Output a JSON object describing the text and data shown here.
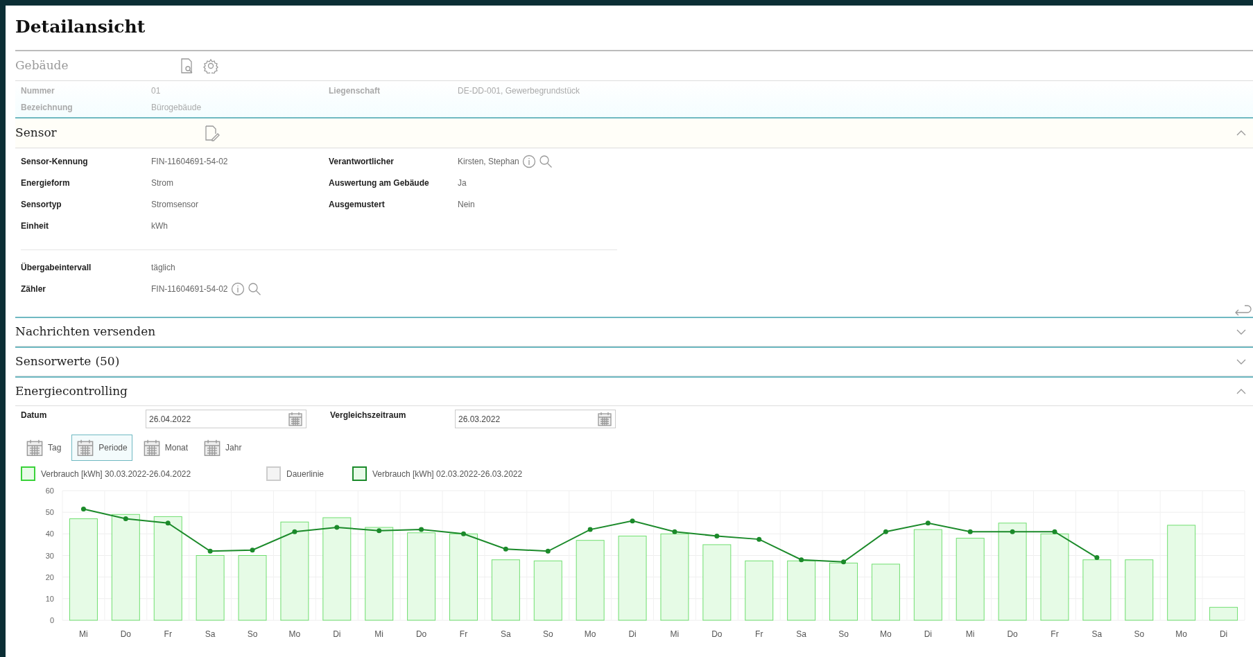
{
  "page_title": "Detailansicht",
  "building": {
    "title": "Gebäude",
    "rows": [
      {
        "cells": [
          {
            "label": "Nummer",
            "value": "01"
          },
          {
            "label": "Liegenschaft",
            "value": "DE-DD-001, Gewerbegrundstück"
          }
        ]
      },
      {
        "cells": [
          {
            "label": "Bezeichnung",
            "value": "Bürogebäude"
          }
        ]
      }
    ]
  },
  "sensor": {
    "title": "Sensor",
    "expanded": true,
    "groups": [
      [
        {
          "cells": [
            {
              "label": "Sensor-Kennung",
              "value": "FIN-11604691-54-02"
            },
            {
              "label": "Verantwortlicher",
              "value": "Kirsten, Stephan",
              "lookup": true
            }
          ]
        },
        {
          "cells": [
            {
              "label": "Energieform",
              "value": "Strom"
            },
            {
              "label": "Auswertung am Gebäude",
              "value": "Ja"
            }
          ]
        },
        {
          "cells": [
            {
              "label": "Sensortyp",
              "value": "Stromsensor"
            },
            {
              "label": "Ausgemustert",
              "value": "Nein"
            }
          ]
        },
        {
          "cells": [
            {
              "label": "Einheit",
              "value": "kWh"
            }
          ]
        }
      ],
      [
        {
          "cells": [
            {
              "label": "Übergabeintervall",
              "value": "täglich"
            }
          ]
        },
        {
          "cells": [
            {
              "label": "Zähler",
              "value": "FIN-11604691-54-02",
              "lookup": true
            }
          ]
        }
      ]
    ]
  },
  "collapsed_sections": [
    {
      "title": "Nachrichten versenden",
      "expanded": false
    },
    {
      "title": "Sensorwerte",
      "count": "(50)",
      "expanded": false
    }
  ],
  "energy": {
    "title": "Energiecontrolling",
    "expanded": true,
    "date_fields": [
      {
        "label": "Datum",
        "value": "26.04.2022"
      },
      {
        "label": "Vergleichszeitraum",
        "value": "26.03.2022"
      }
    ],
    "ranges": [
      {
        "label": "Tag",
        "selected": false
      },
      {
        "label": "Periode",
        "selected": true
      },
      {
        "label": "Monat",
        "selected": false
      },
      {
        "label": "Jahr",
        "selected": false
      }
    ],
    "duration_curve": {
      "label": "Dauerlinie",
      "checked": false
    },
    "chart_data": {
      "type": "bar",
      "categories": [
        "Mi",
        "Do",
        "Fr",
        "Sa",
        "So",
        "Mo",
        "Di",
        "Mi",
        "Do",
        "Fr",
        "Sa",
        "So",
        "Mo",
        "Di",
        "Mi",
        "Do",
        "Fr",
        "Sa",
        "So",
        "Mo",
        "Di",
        "Mi",
        "Do",
        "Fr",
        "Sa",
        "So",
        "Mo",
        "Di"
      ],
      "ylim": [
        0,
        60
      ],
      "grid": true,
      "yticks": [
        0,
        10,
        20,
        30,
        40,
        50,
        60
      ],
      "series": [
        {
          "name": "Verbrauch [kWh] 30.03.2022-26.04.2022",
          "color": "#39d239",
          "values": [
            47,
            49,
            48,
            30,
            30,
            45.5,
            47.5,
            43,
            40.5,
            40,
            28,
            27.5,
            37,
            39,
            40,
            35,
            27.5,
            27.5,
            26.5,
            26,
            42,
            38,
            45,
            40,
            28,
            28,
            44,
            6
          ]
        },
        {
          "name": "Verbrauch [kWh] 02.03.2022-26.03.2022",
          "color": "#1b8a2a",
          "type": "line",
          "marker": "circle",
          "values": [
            51.5,
            47,
            45,
            32,
            32.5,
            41,
            43,
            41.5,
            42,
            40,
            33,
            32,
            42,
            46,
            41,
            39,
            37.5,
            28,
            27,
            41,
            45,
            41,
            41,
            41,
            29,
            null,
            null,
            null
          ]
        }
      ]
    }
  }
}
